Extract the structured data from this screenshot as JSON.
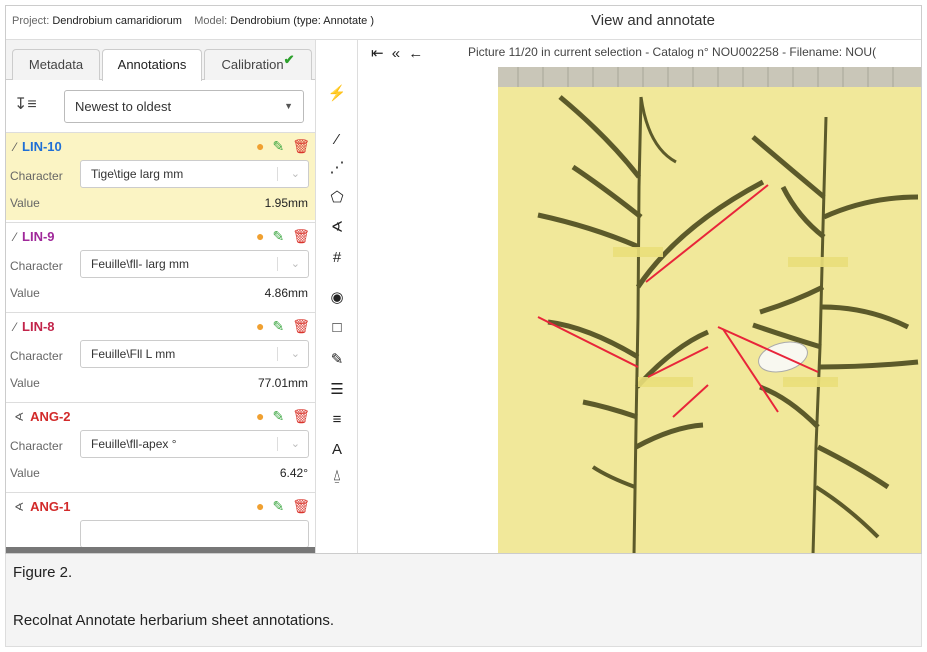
{
  "header": {
    "project_label": "Project:",
    "project_name": "Dendrobium camaridiorum",
    "model_label": "Model:",
    "model_name": "Dendrobium (type: Annotate )",
    "app_title": "View and annotate"
  },
  "tabs": [
    {
      "label": "Metadata",
      "active": false
    },
    {
      "label": "Annotations",
      "active": true
    },
    {
      "label": "Calibration",
      "active": false,
      "check": "✔"
    }
  ],
  "sort": {
    "selected": "Newest to oldest"
  },
  "annotations": [
    {
      "id": "LIN-10",
      "icon": "line-icon",
      "icon_glyph": "⁄",
      "color": "#1f6fd6",
      "character_label": "Character",
      "character": "Tige\\tige larg mm",
      "value_label": "Value",
      "value": "1.95mm",
      "selected": true
    },
    {
      "id": "LIN-9",
      "icon": "line-icon",
      "icon_glyph": "⁄",
      "color": "#a0289a",
      "character_label": "Character",
      "character": "Feuille\\fll- larg mm",
      "value_label": "Value",
      "value": "4.86mm",
      "selected": false
    },
    {
      "id": "LIN-8",
      "icon": "line-icon",
      "icon_glyph": "⁄",
      "color": "#c2244a",
      "character_label": "Character",
      "character": "Feuille\\Fll L mm",
      "value_label": "Value",
      "value": "77.01mm",
      "selected": false
    },
    {
      "id": "ANG-2",
      "icon": "angle-icon",
      "icon_glyph": "∢",
      "color": "#d22a2a",
      "character_label": "Character",
      "character": "Feuille\\fll-apex °",
      "value_label": "Value",
      "value": "6.42°",
      "selected": false
    },
    {
      "id": "ANG-1",
      "icon": "angle-icon",
      "icon_glyph": "∢",
      "color": "#d22a2a",
      "character_label": "",
      "character": "",
      "value_label": "",
      "value": "",
      "selected": false
    }
  ],
  "tools": [
    {
      "name": "lightning-icon",
      "glyph": "⚡"
    },
    {
      "name": "line-tool-icon",
      "glyph": "⁄"
    },
    {
      "name": "polyline-tool-icon",
      "glyph": "⋰"
    },
    {
      "name": "polygon-tool-icon",
      "glyph": "⬠"
    },
    {
      "name": "angle-tool-icon",
      "glyph": "∢"
    },
    {
      "name": "count-tool-icon",
      "glyph": "#"
    },
    {
      "name": "point-of-interest-icon",
      "glyph": "◉"
    },
    {
      "name": "rectangle-tool-icon",
      "glyph": "□"
    },
    {
      "name": "color-picker-icon",
      "glyph": "✎"
    },
    {
      "name": "transcription-icon",
      "glyph": "☰"
    },
    {
      "name": "list-icon",
      "glyph": "≡"
    },
    {
      "name": "text-icon",
      "glyph": "A"
    },
    {
      "name": "inbox-icon",
      "glyph": "⍙"
    }
  ],
  "viewer": {
    "nav_first": "⇤",
    "nav_back_many": "«",
    "nav_back": "←",
    "picture_info": "Picture 11/20 in current selection - Catalog n° NOU002258 - Filename: NOU("
  },
  "caption": {
    "figure_label": "Figure 2.",
    "text": "Recolnat Annotate herbarium sheet annotations."
  },
  "colors": {
    "selected_card": "#fbf4c4",
    "sheet_background": "#f1e89a",
    "annotation_red": "#e8253a",
    "calibration_check": "#2ca02c"
  }
}
